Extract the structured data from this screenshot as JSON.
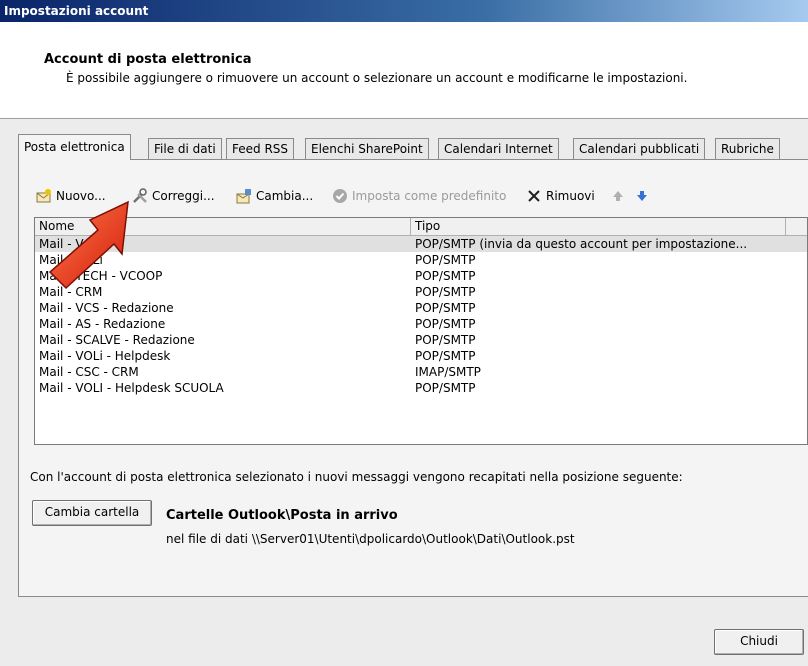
{
  "window": {
    "title": "Impostazioni account"
  },
  "header": {
    "heading": "Account di posta elettronica",
    "description": "È possibile aggiungere o rimuovere un account o selezionare un account e modificarne le impostazioni."
  },
  "tabs": [
    {
      "label": "Posta elettronica",
      "active": true
    },
    {
      "label": "File di dati"
    },
    {
      "label": "Feed RSS"
    },
    {
      "label": "Elenchi SharePoint"
    },
    {
      "label": "Calendari Internet"
    },
    {
      "label": "Calendari pubblicati"
    },
    {
      "label": "Rubriche"
    }
  ],
  "toolbar": {
    "new_label": "Nuovo...",
    "repair_label": "Correggi...",
    "change_label": "Cambia...",
    "default_label": "Imposta come predefinito",
    "remove_label": "Rimuovi"
  },
  "list": {
    "col_name": "Nome",
    "col_type": "Tipo",
    "rows": [
      {
        "name": "Mail - VCS",
        "type": "POP/SMTP (invia da questo account per impostazione...",
        "selected": true
      },
      {
        "name": "Mail - VOLi",
        "type": "POP/SMTP"
      },
      {
        "name": "Mail - TECH - VCOOP",
        "type": "POP/SMTP"
      },
      {
        "name": "Mail - CRM",
        "type": "POP/SMTP"
      },
      {
        "name": "Mail - VCS - Redazione",
        "type": "POP/SMTP"
      },
      {
        "name": "Mail - AS - Redazione",
        "type": "POP/SMTP"
      },
      {
        "name": "Mail - SCALVE - Redazione",
        "type": "POP/SMTP"
      },
      {
        "name": "Mail - VOLi - Helpdesk",
        "type": "POP/SMTP"
      },
      {
        "name": "Mail - CSC - CRM",
        "type": "IMAP/SMTP"
      },
      {
        "name": "Mail -  VOLI - Helpdesk SCUOLA",
        "type": "POP/SMTP"
      }
    ]
  },
  "delivery": {
    "info": "Con l'account di posta elettronica selezionato i nuovi messaggi vengono recapitati nella posizione seguente:",
    "change_folder_label": "Cambia cartella",
    "folder": "Cartelle Outlook\\Posta in arrivo",
    "file": "nel file di dati \\\\Server01\\Utenti\\dpolicardo\\Outlook\\Dati\\Outlook.pst"
  },
  "footer": {
    "close_label": "Chiudi"
  },
  "annotation": {
    "arrow_color": "#e03010"
  }
}
